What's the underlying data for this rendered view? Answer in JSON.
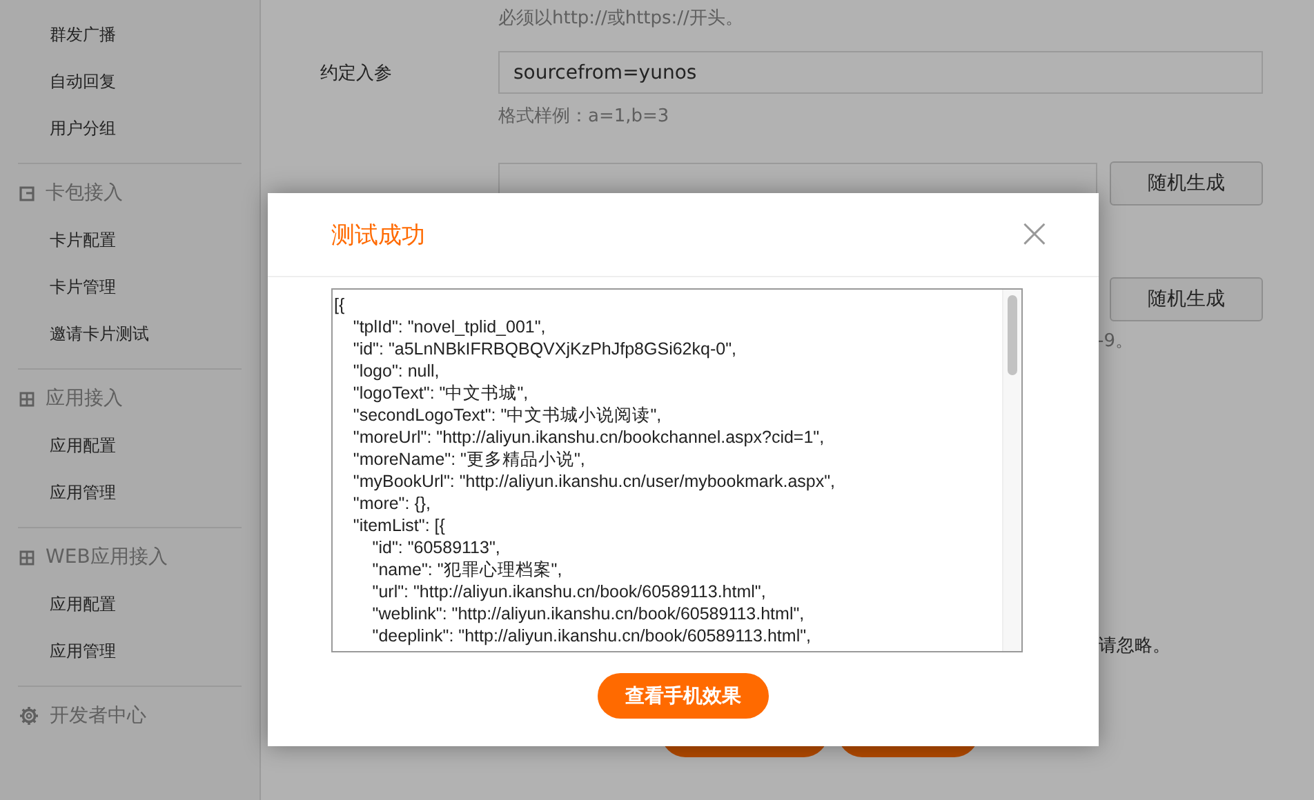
{
  "sidebar": {
    "sections": [
      {
        "items": [
          "群发广播",
          "自动回复",
          "用户分组"
        ]
      },
      {
        "title": "卡包接入",
        "kind": "card",
        "items": [
          "卡片配置",
          "卡片管理",
          "邀请卡片测试"
        ]
      },
      {
        "title": "应用接入",
        "kind": "grid",
        "items": [
          "应用配置",
          "应用管理"
        ]
      },
      {
        "title": "WEB应用接入",
        "kind": "grid",
        "items": [
          "应用配置",
          "应用管理"
        ]
      },
      {
        "title": "开发者中心",
        "kind": "gear"
      }
    ]
  },
  "form": {
    "top_hint": "必须以http://或https://开头。",
    "param": {
      "label": "约定入参",
      "value": "sourcefrom=yunos",
      "hint": "格式样例：a=1,b=3"
    },
    "generate_buttons": [
      "随机生成",
      "随机生成"
    ],
    "key_hint_tail": "-9。",
    "notice_tail": "请忽略。"
  },
  "dialog": {
    "title": "测试成功",
    "close": "×",
    "content": "[{\n    \"tplId\": \"novel_tplid_001\",\n    \"id\": \"a5LnNBkIFRBQBQVXjKzPhJfp8GSi62kq-0\",\n    \"logo\": null,\n    \"logoText\": \"中文书城\",\n    \"secondLogoText\": \"中文书城小说阅读\",\n    \"moreUrl\": \"http://aliyun.ikanshu.cn/bookchannel.aspx?cid=1\",\n    \"moreName\": \"更多精品小说\",\n    \"myBookUrl\": \"http://aliyun.ikanshu.cn/user/mybookmark.aspx\",\n    \"more\": {},\n    \"itemList\": [{\n        \"id\": \"60589113\",\n        \"name\": \"犯罪心理档案\",\n        \"url\": \"http://aliyun.ikanshu.cn/book/60589113.html\",\n        \"weblink\": \"http://aliyun.ikanshu.cn/book/60589113.html\",\n        \"deeplink\": \"http://aliyun.ikanshu.cn/book/60589113.html\",",
    "button": "查看手机效果"
  }
}
